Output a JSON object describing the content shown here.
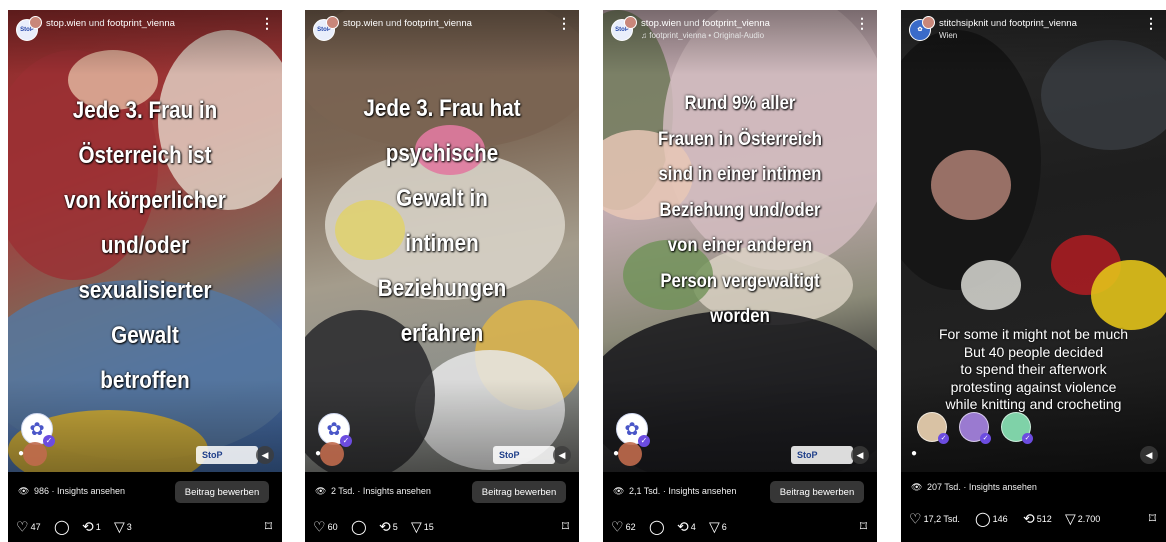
{
  "colors": {
    "card_bg": "#000000",
    "button_bg": "#363636",
    "verified": "#6c4ce0"
  },
  "posts": [
    {
      "accounts": {
        "first": "stop.wien",
        "joiner": "und",
        "second": "footprint_vienna"
      },
      "sub_line": "",
      "overlay": [
        "Jede 3. Frau in",
        "Österreich ist",
        "von körperlicher",
        "und/oder",
        "sexualisierter",
        "Gewalt",
        "betroffen"
      ],
      "logo_text": "StoP",
      "views": "986",
      "insights_label": "Insights ansehen",
      "promote_label": "Beitrag bewerben",
      "likes": "47",
      "reposts": "1",
      "shares": "3"
    },
    {
      "accounts": {
        "first": "stop.wien",
        "joiner": "und",
        "second": "footprint_vienna"
      },
      "sub_line": "",
      "overlay": [
        "Jede 3. Frau hat",
        "psychische",
        "Gewalt in",
        "intimen",
        "Beziehungen",
        "erfahren"
      ],
      "logo_text": "StoP",
      "views": "2 Tsd.",
      "insights_label": "Insights ansehen",
      "promote_label": "Beitrag bewerben",
      "likes": "60",
      "reposts": "5",
      "shares": "15"
    },
    {
      "accounts": {
        "first": "stop.wien",
        "joiner": "und",
        "second": "footprint_vienna"
      },
      "sub_line": "footprint_vienna • Original-Audio",
      "overlay": [
        "Rund 9% aller",
        "Frauen in Österreich",
        "sind in einer intimen",
        "Beziehung und/oder",
        "von einer anderen",
        "Person vergewaltigt",
        "worden"
      ],
      "logo_text": "StoP",
      "views": "2,1 Tsd.",
      "insights_label": "Insights ansehen",
      "promote_label": "Beitrag bewerben",
      "likes": "62",
      "reposts": "4",
      "shares": "6"
    },
    {
      "accounts": {
        "first": "stitchsipknit",
        "joiner": "und",
        "second": "footprint_vienna"
      },
      "sub_line": "Wien",
      "overlay": [
        "For some it might not be much",
        "But 40 people decided",
        "to spend their afterwork",
        "protesting against violence",
        "while knitting and crocheting"
      ],
      "logo_text": "",
      "views": "207 Tsd.",
      "insights_label": "Insights ansehen",
      "promote_label": "",
      "likes": "17,2 Tsd.",
      "comments": "146",
      "reposts": "512",
      "shares": "2.700"
    }
  ],
  "icons": {
    "more": "more-options-icon",
    "view": "eye-icon",
    "like": "heart-icon",
    "comment": "comment-icon",
    "repost": "repost-icon",
    "share": "share-icon",
    "save": "bookmark-icon",
    "mute": "mute-icon"
  }
}
